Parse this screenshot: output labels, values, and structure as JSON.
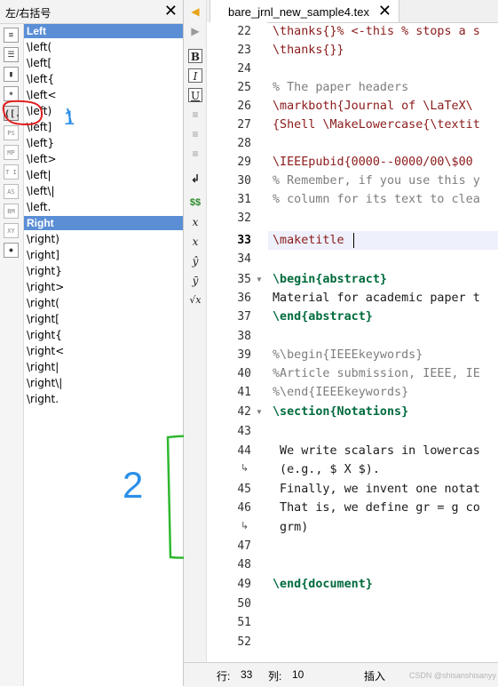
{
  "panel": {
    "title": "左/右括号",
    "close": "✕",
    "categories": [
      {
        "icon": "list-icon",
        "glyph": "≡"
      },
      {
        "icon": "list-alt-icon",
        "glyph": "☰"
      },
      {
        "icon": "bookmark-icon",
        "glyph": "▮"
      },
      {
        "icon": "star-icon",
        "glyph": "✶"
      },
      {
        "icon": "brackets-icon",
        "glyph": "([."
      },
      {
        "icon": "ps-icon",
        "glyph": "PS"
      },
      {
        "icon": "mp-icon",
        "glyph": "MP"
      },
      {
        "icon": "ti-icon",
        "glyph": "T I"
      },
      {
        "icon": "as-icon",
        "glyph": "AS"
      },
      {
        "icon": "bm-icon",
        "glyph": "BM"
      },
      {
        "icon": "xy-icon",
        "glyph": "XY"
      },
      {
        "icon": "special-icon",
        "glyph": "✸"
      }
    ],
    "left_header": "Left",
    "left_items": [
      "\\left(",
      "\\left[",
      "\\left{",
      "\\left<",
      "\\left)",
      "\\left]",
      "\\left}",
      "\\left>",
      "\\left|",
      "\\left\\|",
      "\\left."
    ],
    "right_header": "Right",
    "right_items": [
      "\\right)",
      "\\right]",
      "\\right}",
      "\\right>",
      "\\right(",
      "\\right[",
      "\\right{",
      "\\right<",
      "\\right|",
      "\\right\\|",
      "\\right."
    ],
    "annotation_1": "1",
    "annotation_2": "2"
  },
  "toolbar": {
    "tools": [
      "back-arrow-icon",
      "forward-arrow-icon",
      "bold-icon",
      "italic-icon",
      "underline-icon",
      "align-left-icon",
      "align-center-icon",
      "align-right-icon",
      "newline-icon",
      "math-dollar-icon",
      "subscript-icon",
      "superscript-icon",
      "hat-icon",
      "bar-icon",
      "sqrt-icon"
    ],
    "bold": "B",
    "italic": "I",
    "underline": "U",
    "dollar": "$$",
    "newline": "↲",
    "sub": "x",
    "sup": "x",
    "hat": "ŷ",
    "bar": "ȳ",
    "sqrt": "√x"
  },
  "editor": {
    "tab_name": "bare_jrnl_new_sample4.tex",
    "tab_close": "✕",
    "lines": [
      {
        "n": "22",
        "text": "\\thanks{}% <-this % stops a s"
      },
      {
        "n": "23",
        "text": "\\thanks{}}"
      },
      {
        "n": "24",
        "text": ""
      },
      {
        "n": "25",
        "text": "% The paper headers"
      },
      {
        "n": "26",
        "text": "\\markboth{Journal of \\LaTeX\\"
      },
      {
        "n": "27",
        "text": "{Shell \\MakeLowercase{\\textit"
      },
      {
        "n": "28",
        "text": ""
      },
      {
        "n": "29",
        "text": "\\IEEEpubid{0000--0000/00\\$00"
      },
      {
        "n": "30",
        "text": "% Remember, if you use this y"
      },
      {
        "n": "31",
        "text": "% column for its text to clea"
      },
      {
        "n": "32",
        "text": ""
      },
      {
        "n": "33",
        "text": "\\maketitle"
      },
      {
        "n": "34",
        "text": ""
      },
      {
        "n": "35",
        "text": "\\begin{abstract}"
      },
      {
        "n": "36",
        "text": "Material for academic paper t"
      },
      {
        "n": "37",
        "text": "\\end{abstract}"
      },
      {
        "n": "38",
        "text": ""
      },
      {
        "n": "39",
        "text": "%\\begin{IEEEkeywords}"
      },
      {
        "n": "40",
        "text": "%Article submission, IEEE, IE"
      },
      {
        "n": "41",
        "text": "%\\end{IEEEkeywords}"
      },
      {
        "n": "42",
        "text": "\\section{Notations}"
      },
      {
        "n": "43",
        "text": ""
      },
      {
        "n": "44",
        "text": " We write scalars in lowercas"
      },
      {
        "n": "",
        "text": " (e.g., $ X $)."
      },
      {
        "n": "45",
        "text": " Finally, we invent one notat"
      },
      {
        "n": "46",
        "text": " That is, we define gr = g co"
      },
      {
        "n": "",
        "text": " grm)"
      },
      {
        "n": "47",
        "text": ""
      },
      {
        "n": "48",
        "text": ""
      },
      {
        "n": "49",
        "text": "\\end{document}"
      },
      {
        "n": "50",
        "text": ""
      },
      {
        "n": "51",
        "text": ""
      },
      {
        "n": "52",
        "text": ""
      }
    ],
    "current_line": "33"
  },
  "status": {
    "row_label": "行:",
    "row": "33",
    "col_label": "列:",
    "col": "10",
    "mode": "插入",
    "watermark": "CSDN @shisanshisanyy"
  },
  "colors": {
    "accent": "#5a8fd6",
    "annotation_red": "#e02020",
    "annotation_blue": "#2b8fe8",
    "annotation_green": "#2fb82f"
  }
}
